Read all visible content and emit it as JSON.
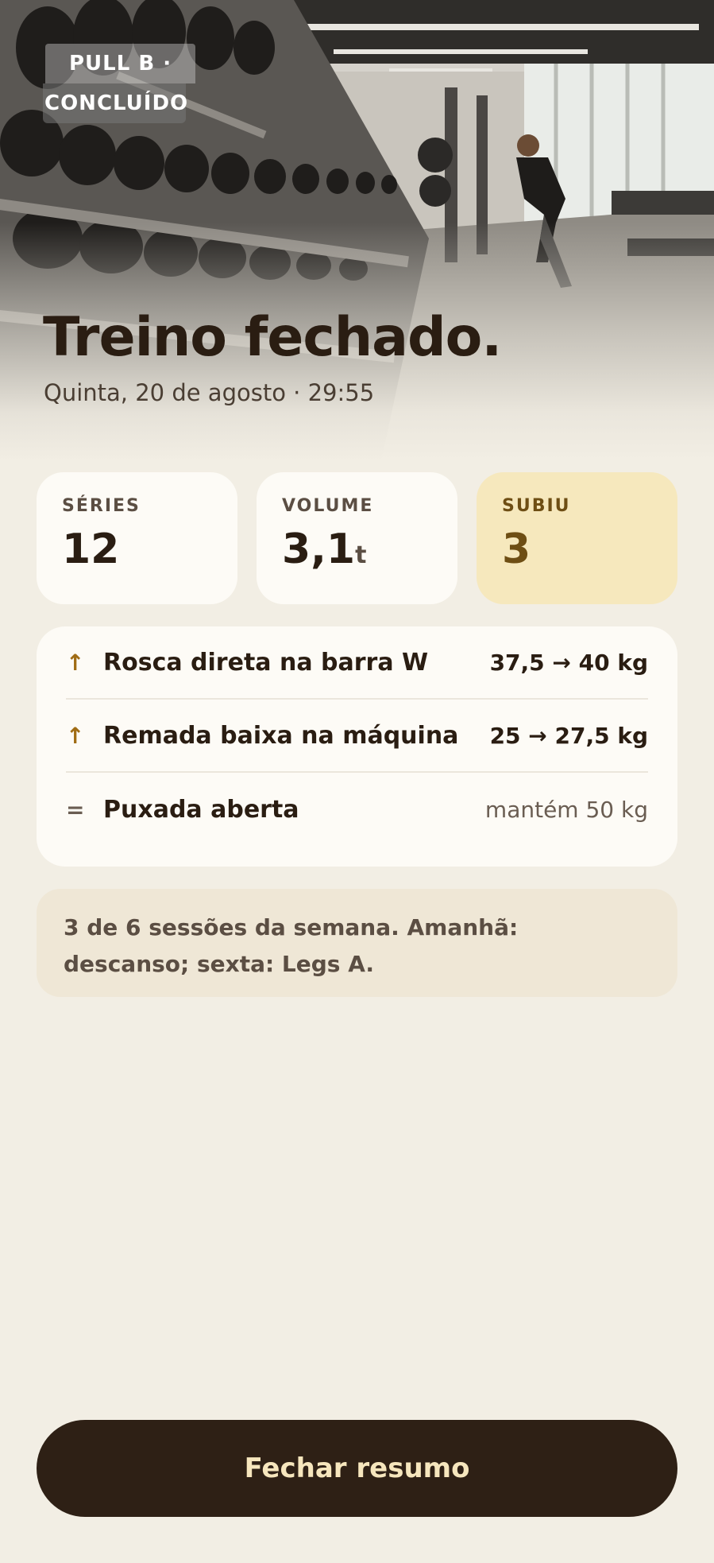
{
  "hero": {
    "badge_line1": "PULL B ·",
    "badge_line2": "CONCLUÍDO",
    "title": "Treino fechado.",
    "subtitle": "Quinta, 20 de agosto · 29:55",
    "image_icon": "gym-photo"
  },
  "stats": [
    {
      "label": "SÉRIES",
      "value": "12",
      "unit": ""
    },
    {
      "label": "VOLUME",
      "value": "3,1",
      "unit": "t"
    },
    {
      "label": "SUBIU",
      "value": "3",
      "unit": ""
    }
  ],
  "exercises": [
    {
      "symbol": "↑",
      "icon": "arrow-up-icon",
      "name": "Rosca direta na barra W",
      "change": "37,5 → 40 kg"
    },
    {
      "symbol": "↑",
      "icon": "arrow-up-icon",
      "name": "Remada baixa na máquina",
      "change": "25 → 27,5 kg"
    },
    {
      "symbol": "=",
      "icon": "equals-icon",
      "name": "Puxada aberta",
      "change": "mantém 50 kg"
    }
  ],
  "note": "3 de 6 sessões da semana. Amanhã: descanso; sexta: Legs A.",
  "button": {
    "label": "Fechar resumo"
  },
  "colors": {
    "background": "#f2eee4",
    "card": "#fdfbf6",
    "highlight": "#f6e8bd",
    "accent": "#a06c14",
    "button_bg": "#2e2015",
    "button_text": "#f6e6bd"
  }
}
